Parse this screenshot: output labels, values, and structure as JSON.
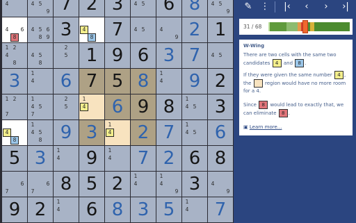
{
  "toolbar": {
    "items": [
      {
        "icon": "pencil-icon",
        "glyph": "✎"
      },
      {
        "icon": "more-options-icon",
        "glyph": "⋮"
      },
      {
        "icon": "first-step-icon",
        "glyph": "|‹"
      },
      {
        "icon": "previous-step-icon",
        "glyph": "‹"
      },
      {
        "icon": "next-step-icon",
        "glyph": "›"
      },
      {
        "icon": "last-step-icon",
        "glyph": "›|"
      }
    ]
  },
  "progress": {
    "text": "31 / 68",
    "current": 31,
    "total": 68
  },
  "hint": {
    "title": "W-Wing",
    "p1a": "There are two cells with the same two candidates",
    "p1_c1": "4",
    "p1_and": "and",
    "p1_c2": "8",
    "p1_end": ".",
    "p2a": "If they were given the same number",
    "p2_c": "4",
    "p2b": ", the",
    "p2c": "region would have no more room for a",
    "p2_num": "4",
    "p2_end": ".",
    "p3a": "Since",
    "p3_c1": "8",
    "p3b": "would lead to exactly that, we can eliminate",
    "p3_c2": "8",
    "p3_end": ".",
    "learn_more": "Learn more..."
  },
  "colors": {
    "background": "#2b4580",
    "cell": "#a8b3c6",
    "selected_cell": "#ffffff",
    "box_highlight": "#aea185",
    "region_highlight": "#f8e3bf",
    "given_digit": "#161616",
    "user_digit": "#2f63ad",
    "candidate_yellow": "#f3ee8c",
    "candidate_blue": "#9cc7ea",
    "candidate_red": "#e0757a"
  },
  "board": [
    [
      {
        "c": [
          {
            "d": "4"
          }
        ]
      },
      {
        "c": [
          {
            "d": "4"
          },
          {
            "d": "5"
          },
          {
            "d": "9"
          }
        ]
      },
      {
        "v": "7",
        "k": "given"
      },
      {
        "v": "2",
        "k": "given"
      },
      {
        "v": "3",
        "k": "given"
      },
      {
        "c": [
          {
            "d": "4"
          },
          {
            "d": "5"
          }
        ]
      },
      {
        "v": "6",
        "k": "given"
      },
      {
        "v": "8",
        "k": "user"
      },
      {
        "c": [
          {
            "d": "4"
          },
          {
            "d": "5"
          },
          {
            "d": "9"
          }
        ]
      }
    ],
    [
      {
        "bg": "white",
        "c": [
          {
            "d": "4"
          },
          {
            "d": "6"
          },
          {
            "d": "8",
            "h": "r"
          }
        ]
      },
      {
        "c": [
          {
            "d": "4"
          },
          {
            "d": "5"
          },
          {
            "d": "6"
          },
          {
            "d": "8"
          },
          {
            "d": "9"
          }
        ]
      },
      {
        "v": "3",
        "k": "given"
      },
      {
        "bg": "white",
        "c": [
          {
            "d": "4",
            "h": "y"
          },
          {
            "d": "8",
            "h": "b"
          }
        ]
      },
      {
        "v": "7",
        "k": "given"
      },
      {
        "c": [
          {
            "d": "4"
          },
          {
            "d": "5"
          }
        ]
      },
      {
        "c": [
          {
            "d": "4"
          },
          {
            "d": "9"
          }
        ]
      },
      {
        "v": "2",
        "k": "user"
      },
      {
        "v": "1",
        "k": "given"
      }
    ],
    [
      {
        "c": [
          {
            "d": "1"
          },
          {
            "d": "2"
          },
          {
            "d": "4"
          },
          {
            "d": "8"
          }
        ]
      },
      {
        "c": [
          {
            "d": "4"
          },
          {
            "d": "5"
          },
          {
            "d": "8"
          }
        ]
      },
      {
        "c": [
          {
            "d": "2"
          },
          {
            "d": "5"
          }
        ]
      },
      {
        "v": "1",
        "k": "given"
      },
      {
        "v": "9",
        "k": "given"
      },
      {
        "v": "6",
        "k": "given"
      },
      {
        "v": "3",
        "k": "user"
      },
      {
        "v": "7",
        "k": "user"
      },
      {
        "c": [
          {
            "d": "4"
          },
          {
            "d": "5"
          }
        ]
      }
    ],
    [
      {
        "v": "3",
        "k": "user"
      },
      {
        "c": [
          {
            "d": "1"
          },
          {
            "d": "4"
          }
        ]
      },
      {
        "v": "6",
        "k": "user"
      },
      {
        "v": "7",
        "k": "given",
        "bg": "tan"
      },
      {
        "v": "5",
        "k": "given",
        "bg": "tan"
      },
      {
        "v": "8",
        "k": "user",
        "bg": "tan"
      },
      {
        "c": [
          {
            "d": "1"
          },
          {
            "d": "4"
          }
        ]
      },
      {
        "v": "9",
        "k": "user"
      },
      {
        "v": "2",
        "k": "given"
      }
    ],
    [
      {
        "c": [
          {
            "d": "1"
          },
          {
            "d": "2"
          },
          {
            "d": "7"
          }
        ]
      },
      {
        "c": [
          {
            "d": "1"
          },
          {
            "d": "4"
          },
          {
            "d": "5"
          },
          {
            "d": "7"
          }
        ]
      },
      {
        "c": [
          {
            "d": "2"
          },
          {
            "d": "5"
          }
        ]
      },
      {
        "bg": "cream",
        "c": [
          {
            "d": "1"
          },
          {
            "d": "4",
            "h": "y"
          }
        ]
      },
      {
        "v": "6",
        "k": "user",
        "bg": "tan"
      },
      {
        "v": "9",
        "k": "given",
        "bg": "tan"
      },
      {
        "v": "8",
        "k": "given"
      },
      {
        "c": [
          {
            "d": "1"
          },
          {
            "d": "4"
          },
          {
            "d": "5"
          }
        ]
      },
      {
        "v": "3",
        "k": "given"
      }
    ],
    [
      {
        "bg": "white",
        "c": [
          {
            "d": "4",
            "h": "y"
          },
          {
            "d": "8",
            "h": "b"
          }
        ]
      },
      {
        "c": [
          {
            "d": "1"
          },
          {
            "d": "4"
          },
          {
            "d": "5"
          },
          {
            "d": "8"
          }
        ]
      },
      {
        "v": "9",
        "k": "user"
      },
      {
        "v": "3",
        "k": "user",
        "bg": "tan"
      },
      {
        "bg": "cream",
        "c": [
          {
            "d": "1"
          },
          {
            "d": "4",
            "h": "y"
          }
        ]
      },
      {
        "v": "2",
        "k": "user",
        "bg": "tan"
      },
      {
        "v": "7",
        "k": "user"
      },
      {
        "c": [
          {
            "d": "1"
          },
          {
            "d": "4"
          },
          {
            "d": "5"
          }
        ]
      },
      {
        "v": "6",
        "k": "user"
      }
    ],
    [
      {
        "v": "5",
        "k": "given"
      },
      {
        "v": "3",
        "k": "user"
      },
      {
        "c": [
          {
            "d": "1"
          },
          {
            "d": "4"
          }
        ]
      },
      {
        "v": "9",
        "k": "given"
      },
      {
        "c": [
          {
            "d": "1"
          },
          {
            "d": "4"
          }
        ]
      },
      {
        "v": "7",
        "k": "user"
      },
      {
        "v": "2",
        "k": "user"
      },
      {
        "v": "6",
        "k": "given"
      },
      {
        "v": "8",
        "k": "given"
      }
    ],
    [
      {
        "c": [
          {
            "d": "6"
          },
          {
            "d": "7"
          }
        ]
      },
      {
        "c": [
          {
            "d": "6"
          },
          {
            "d": "7"
          }
        ]
      },
      {
        "v": "8",
        "k": "given"
      },
      {
        "v": "5",
        "k": "given"
      },
      {
        "v": "2",
        "k": "given"
      },
      {
        "c": [
          {
            "d": "1"
          },
          {
            "d": "4"
          }
        ]
      },
      {
        "c": [
          {
            "d": "1"
          },
          {
            "d": "4"
          },
          {
            "d": "9"
          }
        ]
      },
      {
        "v": "3",
        "k": "given"
      },
      {
        "c": [
          {
            "d": "4"
          },
          {
            "d": "9"
          }
        ]
      }
    ],
    [
      {
        "v": "9",
        "k": "given"
      },
      {
        "v": "2",
        "k": "given"
      },
      {
        "c": [
          {
            "d": "1"
          },
          {
            "d": "4"
          }
        ]
      },
      {
        "v": "6",
        "k": "given"
      },
      {
        "v": "8",
        "k": "user"
      },
      {
        "v": "3",
        "k": "user"
      },
      {
        "v": "5",
        "k": "user"
      },
      {
        "c": [
          {
            "d": "1"
          },
          {
            "d": "4"
          }
        ]
      },
      {
        "v": "7",
        "k": "user"
      }
    ]
  ]
}
